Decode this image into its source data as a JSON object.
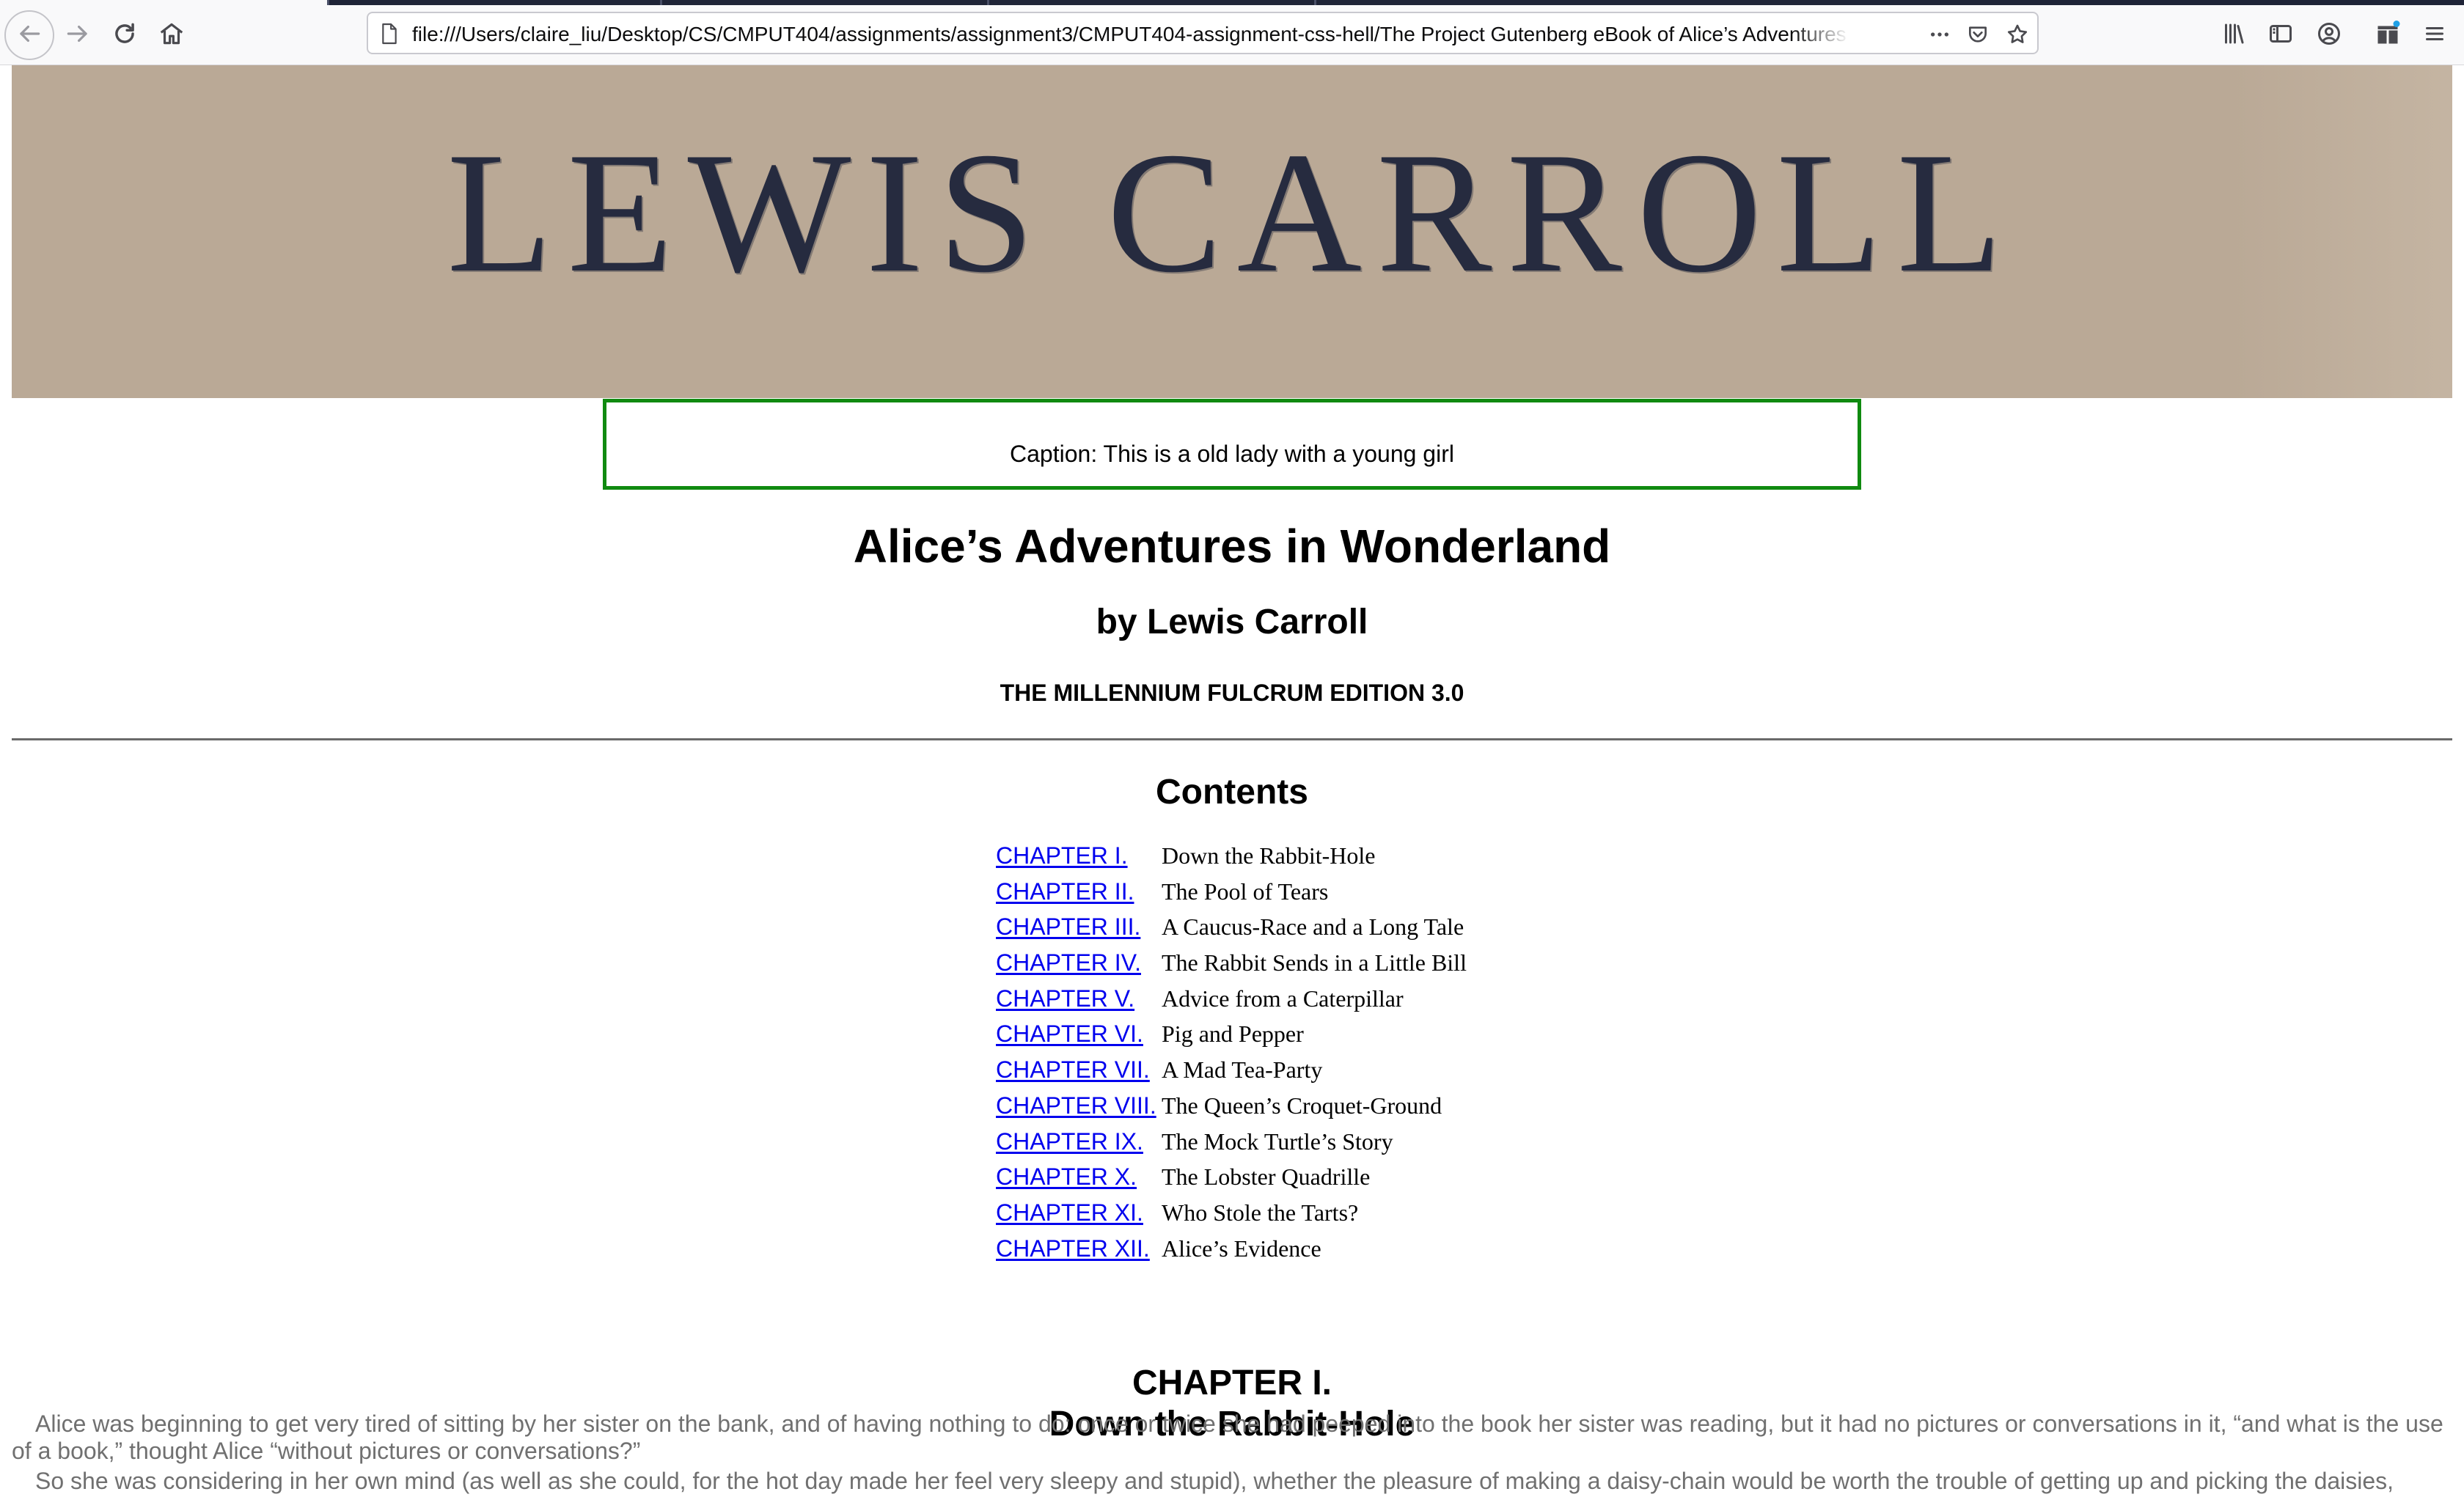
{
  "browser": {
    "url": "file:///Users/claire_liu/Desktop/CS/CMPUT404/assignments/assignment3/CMPUT404-assignment-css-hell/The Project Gutenberg eBook of Alice’s Adventures in Wonderland.html",
    "icons": {
      "back": "back-arrow-icon",
      "forward": "forward-arrow-icon",
      "reload": "reload-icon",
      "home": "home-icon",
      "page": "page-icon",
      "more": "more-actions-icon",
      "pocket": "pocket-icon",
      "bookmark": "star-icon",
      "library": "library-icon",
      "sidebar": "sidebar-icon",
      "account": "account-icon",
      "extensions": "extensions-icon",
      "menu": "hamburger-menu-icon"
    }
  },
  "page": {
    "banner_text": "LEWIS CARROLL",
    "caption": "Caption: This is a old lady with a young girl",
    "title": "Alice’s Adventures in Wonderland",
    "author": "by Lewis Carroll",
    "edition": "THE MILLENNIUM FULCRUM EDITION 3.0",
    "contents_heading": "Contents",
    "toc": [
      {
        "chapter": "CHAPTER I.",
        "title": "Down the Rabbit-Hole"
      },
      {
        "chapter": "CHAPTER II.",
        "title": "The Pool of Tears"
      },
      {
        "chapter": "CHAPTER III.",
        "title": "A Caucus-Race and a Long Tale"
      },
      {
        "chapter": "CHAPTER IV.",
        "title": "The Rabbit Sends in a Little Bill"
      },
      {
        "chapter": "CHAPTER V.",
        "title": "Advice from a Caterpillar"
      },
      {
        "chapter": "CHAPTER VI.",
        "title": "Pig and Pepper"
      },
      {
        "chapter": "CHAPTER VII.",
        "title": "A Mad Tea-Party"
      },
      {
        "chapter": "CHAPTER VIII.",
        "title": "The Queen’s Croquet-Ground"
      },
      {
        "chapter": "CHAPTER IX.",
        "title": "The Mock Turtle’s Story"
      },
      {
        "chapter": "CHAPTER X.",
        "title": "The Lobster Quadrille"
      },
      {
        "chapter": "CHAPTER XI.",
        "title": "Who Stole the Tarts?"
      },
      {
        "chapter": "CHAPTER XII.",
        "title": "Alice’s Evidence"
      }
    ],
    "chapter_heading": {
      "number": "CHAPTER I.",
      "title": "Down the Rabbit-Hole"
    },
    "paragraphs": [
      "Alice was beginning to get very tired of sitting by her sister on the bank, and of having nothing to do: once or twice she had peeped into the book her sister was reading, but it had no pictures or conversations in it, “and what is the use of a book,” thought Alice “without pictures or conversations?”",
      "So she was considering in her own mind (as well as she could, for the hot day made her feel very sleepy and stupid), whether the pleasure of making a daisy-chain would be worth the trouble of getting up and picking the daisies,"
    ]
  },
  "colors": {
    "banner_bg": "#baa996",
    "banner_text": "#262b3f",
    "caption_border": "#108a10",
    "link": "#0000ee",
    "paragraph_text": "#707070"
  }
}
